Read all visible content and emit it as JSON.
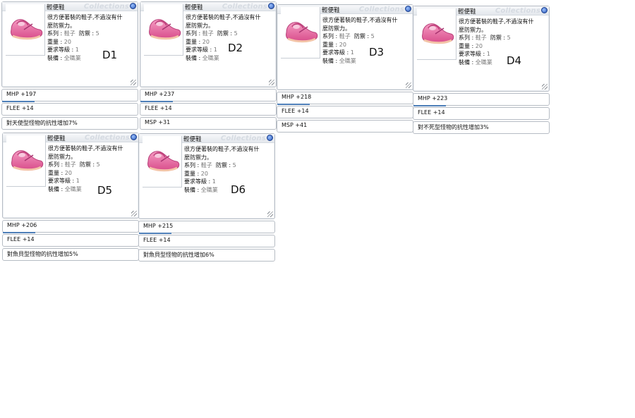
{
  "cards": [
    {
      "id": "D1",
      "name": "輕便鞋",
      "watermark": "Collections",
      "desc_line1": "很方便著裝的鞋子,不過沒有什",
      "desc_line2": "麼防禦力。",
      "series_label": "系列",
      "series_value": "鞋子",
      "defense_label": "防禦",
      "defense_value": "5",
      "weight_label": "重量",
      "weight_value": "20",
      "level_label": "要求等級",
      "level_value": "1",
      "equip_label": "裝備",
      "equip_value": "全職業",
      "stats": [
        "MHP +197",
        "FLEE +14",
        "對天使型怪物的抗性增加7%"
      ]
    },
    {
      "id": "D2",
      "name": "輕便鞋",
      "watermark": "Collections",
      "desc_line1": "很方便著裝的鞋子,不過沒有什",
      "desc_line2": "麼防禦力。",
      "series_label": "系列",
      "series_value": "鞋子",
      "defense_label": "防禦",
      "defense_value": "5",
      "weight_label": "重量",
      "weight_value": "20",
      "level_label": "要求等級",
      "level_value": "1",
      "equip_label": "裝備",
      "equip_value": "全職業",
      "stats": [
        "MHP +237",
        "FLEE +14",
        "MSP +31"
      ]
    },
    {
      "id": "D3",
      "name": "輕便鞋",
      "watermark": "Collections",
      "desc_line1": "很方便著裝的鞋子,不過沒有什",
      "desc_line2": "麼防禦力。",
      "series_label": "系列",
      "series_value": "鞋子",
      "defense_label": "防禦",
      "defense_value": "5",
      "weight_label": "重量",
      "weight_value": "20",
      "level_label": "要求等級",
      "level_value": "1",
      "equip_label": "裝備",
      "equip_value": "全職業",
      "stats": [
        "MHP +218",
        "FLEE +14",
        "MSP +41"
      ]
    },
    {
      "id": "D4",
      "name": "輕便鞋",
      "watermark": "Collections",
      "desc_line1": "很方便著裝的鞋子,不過沒有什",
      "desc_line2": "麼防禦力。",
      "series_label": "系列",
      "series_value": "鞋子",
      "defense_label": "防禦",
      "defense_value": "5",
      "weight_label": "重量",
      "weight_value": "20",
      "level_label": "要求等級",
      "level_value": "1",
      "equip_label": "裝備",
      "equip_value": "全職業",
      "stats": [
        "MHP +223",
        "FLEE +14",
        "對不死型怪物的抗性增加3%"
      ]
    },
    {
      "id": "D5",
      "name": "輕便鞋",
      "watermark": "Collections",
      "desc_line1": "很方便著裝的鞋子,不過沒有什",
      "desc_line2": "麼防禦力。",
      "series_label": "系列",
      "series_value": "鞋子",
      "defense_label": "防禦",
      "defense_value": "5",
      "weight_label": "重量",
      "weight_value": "20",
      "level_label": "要求等級",
      "level_value": "1",
      "equip_label": "裝備",
      "equip_value": "全職業",
      "stats": [
        "MHP +206",
        "FLEE +14",
        "對魚貝型怪物的抗性增加5%"
      ]
    },
    {
      "id": "D6",
      "name": "輕便鞋",
      "watermark": "Collections",
      "desc_line1": "很方便著裝的鞋子,不過沒有什",
      "desc_line2": "麼防禦力。",
      "series_label": "系列",
      "series_value": "鞋子",
      "defense_label": "防禦",
      "defense_value": "5",
      "weight_label": "重量",
      "weight_value": "20",
      "level_label": "要求等級",
      "level_value": "1",
      "equip_label": "裝備",
      "equip_value": "全職業",
      "stats": [
        "MHP +215",
        "FLEE +14",
        "對魚貝型怪物的抗性增加6%"
      ]
    }
  ],
  "colors": {
    "border": "#b6bcc4",
    "accent": "#4e7fb8",
    "shoe": "#e86aa0"
  }
}
